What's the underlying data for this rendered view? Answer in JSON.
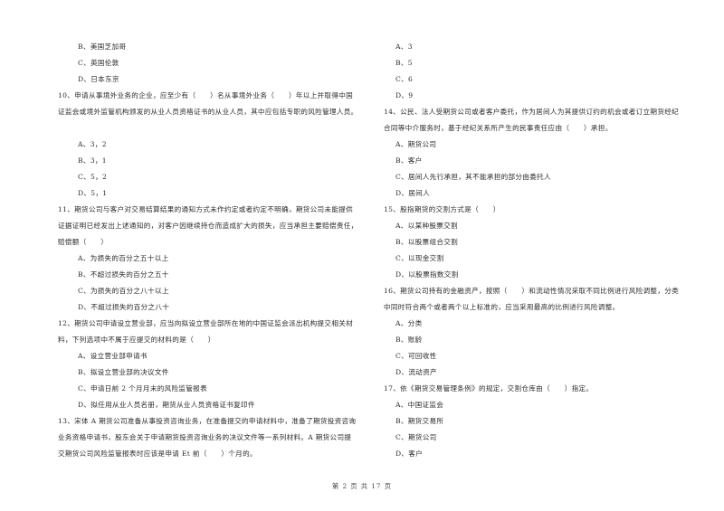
{
  "left_column": {
    "q9_tail_options": [
      "B、美国芝加哥",
      "C、英国伦敦",
      "D、日本东京"
    ],
    "q10": {
      "lines": [
        "10、申请从事境外业务的企业，应至少有（　　）名从事境外业务（　　）年以上并取得中国",
        "证监会或境外监管机构颁发的从业人员资格证书的从业人员，其中应包括专职的风险管理人员。"
      ],
      "options": [
        "A、3，2",
        "B、3，1",
        "C、5，2",
        "D、5，1"
      ]
    },
    "q11": {
      "lines": [
        "11、期货公司与客户对交易结算结果的通知方式未作约定或者约定不明确，期货公司未能提供",
        "证据证明已经发出上述通知的，对客户因继续持仓而造成扩大的损失，应当承担主要赔偿责任，",
        "赔偿额（　　）"
      ],
      "options": [
        "A、为损失的百分之五十以上",
        "B、不超过损失的百分之五十",
        "C、为损失的百分之八十以上",
        "D、不超过损失的百分之八十"
      ]
    },
    "q12": {
      "lines": [
        "12、期货公司申请设立营业部，应当向拟设立营业部所在地的中国证监会派出机构提交相关材",
        "料，下列选项中不属于应提交的材料的是（　　）"
      ],
      "options": [
        "A、设立营业部申请书",
        "B、拟设立营业部的决议文件",
        "C、申请日前 2 个月月末的风险监管报表",
        "D、拟任用从业人员名册，期货从业人员资格证书复印件"
      ]
    },
    "q13": {
      "lines": [
        "13、宋体 A 期货公司准备从事投资咨询业务，在准备提交的申请材料中，准备了期货投资咨询",
        "业务资格申请书，股东会关于申请期货投资咨询业务的决议文件等一系列材料。A 期货公司提",
        "交期货公司风险监管报表时应该是申请 Et 前（　　）个月的。"
      ]
    }
  },
  "right_column": {
    "q13_options": [
      "A、3",
      "B、5",
      "C、6",
      "D、9"
    ],
    "q14": {
      "lines": [
        "14、公民、法人受期货公司或者客户委托，作为居间人为其提供订约的机会或者订立期货经纪",
        "合同等中介服务时，基于经纪关系所产生的民事责任应由（　　）承担。"
      ],
      "options": [
        "A、期货公司",
        "B、客户",
        "C、居间人先行承担，其不能承担的部分由委托人",
        "D、居间人"
      ]
    },
    "q15": {
      "lines": [
        "15、股指期货的交割方式是（　　）"
      ],
      "options": [
        "A、以某种股票交割",
        "B、以股票组合交割",
        "C、以现金交割",
        "D、以股票指数交割"
      ]
    },
    "q16": {
      "lines": [
        "16、期货公司持有的金融资产，按照（　　）和流动性情况采取不同比例进行风险调整，分类",
        "中同时符合两个或者两个以上标准的，应当采用最高的比例进行风险调整。"
      ],
      "options": [
        "A、分类",
        "B、账龄",
        "C、可回收性",
        "D、流动资产"
      ]
    },
    "q17": {
      "lines": [
        "17、依《期货交易管理条例》的规定，交割仓库由（　　）指定。"
      ],
      "options": [
        "A、中国证监会",
        "B、期货交易所",
        "C、期货公司",
        "D、客户"
      ]
    }
  },
  "footer": {
    "page_label": "第 2 页 共 17 页"
  }
}
